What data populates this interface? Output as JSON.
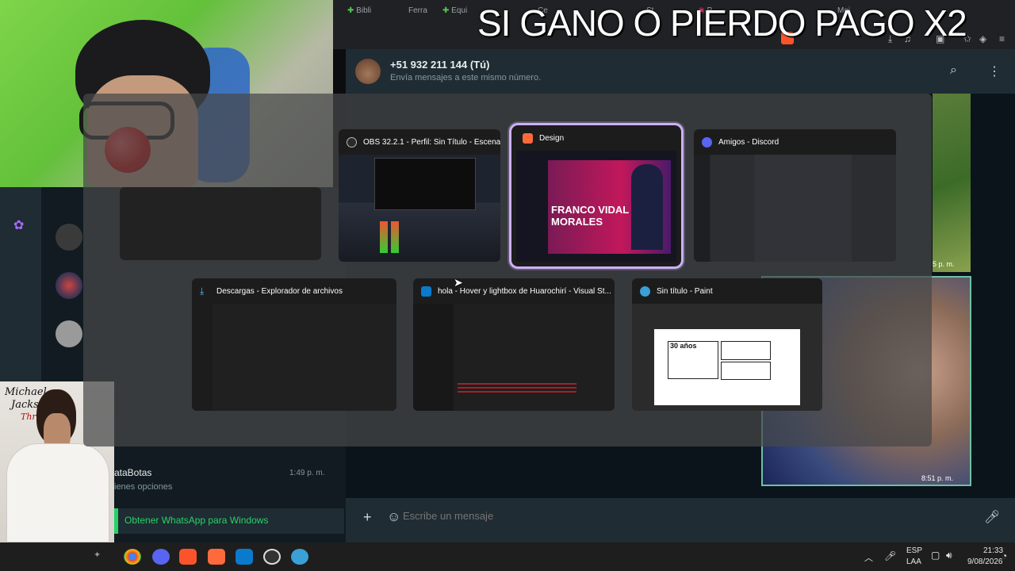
{
  "overlay_title": "SI GANO O PIERDO PAGO X2",
  "browser_tabs": [
    "Bibli",
    "Ferra",
    "Equi",
    "Ce",
    "St",
    "P",
    "Mej"
  ],
  "whatsapp": {
    "contact_name": "+51 932 211 144 (Tú)",
    "contact_subtitle": "Envía mensajes a este mismo número.",
    "chat_list_item": {
      "name": "ataBotas",
      "preview": "ienes opciones",
      "time": "1:49 p. m."
    },
    "get_app_banner": "Obtener WhatsApp para Windows",
    "message_placeholder": "Escribe un mensaje",
    "msg_time_1": "5 p. m.",
    "msg_time_2": "8:51 p. m."
  },
  "switcher": {
    "windows": [
      {
        "title": "OBS 32.2.1 - Perfil: Sin Título - Escena...",
        "icon": "obs-icon"
      },
      {
        "title": "Design",
        "icon": "canva-design-icon",
        "selected": true,
        "thumb_headline": "FRANCO VIDAL MORALES"
      },
      {
        "title": "Amigos - Discord",
        "icon": "discord-icon"
      },
      {
        "title": "Descargas - Explorador de archivos",
        "icon": "download-folder-icon"
      },
      {
        "title": "hola - Hover y lightbox de Huarochirí - Visual St...",
        "icon": "vscode-icon"
      },
      {
        "title": "Sin título - Paint",
        "icon": "paint-icon",
        "thumb_text": "30 años"
      }
    ]
  },
  "album": {
    "script_line1": "Michael",
    "script_line2": "Jackson",
    "script_line3": "Thriller"
  },
  "taskbar": {
    "lang": "ESP",
    "lang2": "LAA",
    "time": "21:33",
    "date": "9/08/2026",
    "icons": [
      "chrome-icon",
      "discord-icon",
      "brave-icon",
      "canva-icon",
      "vscode-icon",
      "obs-icon",
      "paint-icon"
    ]
  },
  "colors": {
    "selection_border": "#cdb0f7",
    "wa_green": "#25d366",
    "wa_bg": "#0b141a"
  }
}
